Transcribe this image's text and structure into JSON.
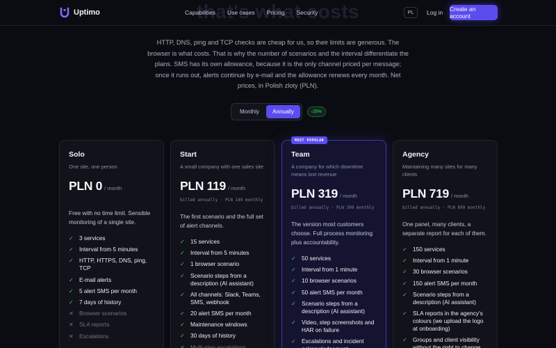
{
  "header": {
    "brand": "Uptimo",
    "ghost_title": "that's what costs",
    "nav": [
      "Capabilities",
      "Use cases",
      "Pricing",
      "Security"
    ],
    "lang": "PL",
    "login": "Log in",
    "cta": "Create an account",
    "accent": "#5b4cf0"
  },
  "intro": "HTTP, DNS, ping and TCP checks are cheap for us, so their limits are generous. The browser is what costs. That is why the number of scenarios and the interval differentiate the plans. SMS has its own allowance, because it is the only channel priced per message; once it runs out, alerts continue by e-mail and the allowance renews every month. Net prices, in Polish zloty (PLN).",
  "billing": {
    "monthly": "Monthly",
    "annually": "Annually",
    "selected": "Annually",
    "discount": "-20%"
  },
  "plans": [
    {
      "name": "Solo",
      "subtitle": "One site, one person",
      "price": "PLN 0",
      "period": "/ month",
      "billed": "",
      "description": "Free with no time limit. Sensible monitoring of a single site.",
      "features": [
        {
          "text": "3 services",
          "included": true
        },
        {
          "text": "Interval from 5 minutes",
          "included": true
        },
        {
          "text": "HTTP, HTTPS, DNS, ping, TCP",
          "included": true
        },
        {
          "text": "E-mail alerts",
          "included": true
        },
        {
          "text": "5 alert SMS per month",
          "included": true
        },
        {
          "text": "7 days of history",
          "included": true
        },
        {
          "text": "Browser scenarios",
          "included": false
        },
        {
          "text": "SLA reports",
          "included": false
        },
        {
          "text": "Escalations",
          "included": false
        }
      ]
    },
    {
      "name": "Start",
      "subtitle": "A small company with one sales site",
      "price": "PLN 119",
      "period": "/ month",
      "billed": "billed annually · PLN 149 monthly",
      "description": "The first scenario and the full set of alert channels.",
      "features": [
        {
          "text": "15 services",
          "included": true
        },
        {
          "text": "Interval from 5 minutes",
          "included": true
        },
        {
          "text": "1 browser scenario",
          "included": true
        },
        {
          "text": "Scenario steps from a description (AI assistant)",
          "included": true
        },
        {
          "text": "All channels: Slack, Teams, SMS, webhook",
          "included": true
        },
        {
          "text": "20 alert SMS per month",
          "included": true
        },
        {
          "text": "Maintenance windows",
          "included": true
        },
        {
          "text": "30 days of history",
          "included": true
        },
        {
          "text": "Multi-step escalations",
          "included": false
        }
      ]
    },
    {
      "name": "Team",
      "badge": "MOST POPULAR",
      "featured": true,
      "subtitle": "A company for which downtime means lost revenue",
      "price": "PLN 319",
      "period": "/ month",
      "billed": "billed annually · PLN 399 monthly",
      "description": "The version most customers choose. Full process monitoring plus accountability.",
      "features": [
        {
          "text": "50 services",
          "included": true
        },
        {
          "text": "Interval from 1 minute",
          "included": true
        },
        {
          "text": "10 browser scenarios",
          "included": true
        },
        {
          "text": "50 alert SMS per month",
          "included": true
        },
        {
          "text": "Scenario steps from a description (AI assistant)",
          "included": true
        },
        {
          "text": "Video, step screenshots and HAR on failure",
          "included": true
        },
        {
          "text": "Escalations and incident acknowledgement",
          "included": true
        }
      ]
    },
    {
      "name": "Agency",
      "subtitle": "Maintaining many sites for many clients",
      "price": "PLN 719",
      "period": "/ month",
      "billed": "billed annually · PLN 899 monthly",
      "description": "One panel, many clients, a separate report for each of them.",
      "features": [
        {
          "text": "150 services",
          "included": true
        },
        {
          "text": "Interval from 1 minute",
          "included": true
        },
        {
          "text": "30 browser scenarios",
          "included": true
        },
        {
          "text": "150 alert SMS per month",
          "included": true
        },
        {
          "text": "Scenario steps from a description (AI assistant)",
          "included": true
        },
        {
          "text": "SLA reports in the agency's colours (we upload the logo at onboarding)",
          "included": true
        },
        {
          "text": "Groups and client visibility without the right to change",
          "included": true
        }
      ]
    }
  ]
}
